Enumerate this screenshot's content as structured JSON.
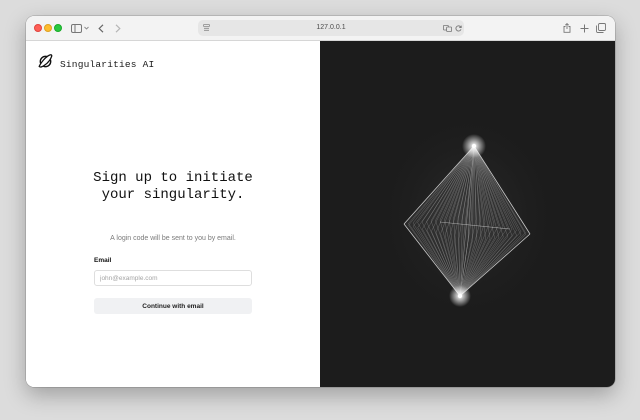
{
  "browser": {
    "url": "127.0.0.1"
  },
  "brand": {
    "name": "Singularities AI",
    "icon": "planet-ring-icon"
  },
  "signup": {
    "headline_line1": "Sign up to initiate",
    "headline_line2": "your singularity.",
    "subtext": "A login code will be sent to you by email.",
    "email_label": "Email",
    "email_placeholder": "john@example.com",
    "email_value": "",
    "continue_label": "Continue with email"
  },
  "colors": {
    "art_background": "#1c1c1c",
    "button_background": "#f0f1f3",
    "glow": "#ffffff"
  }
}
